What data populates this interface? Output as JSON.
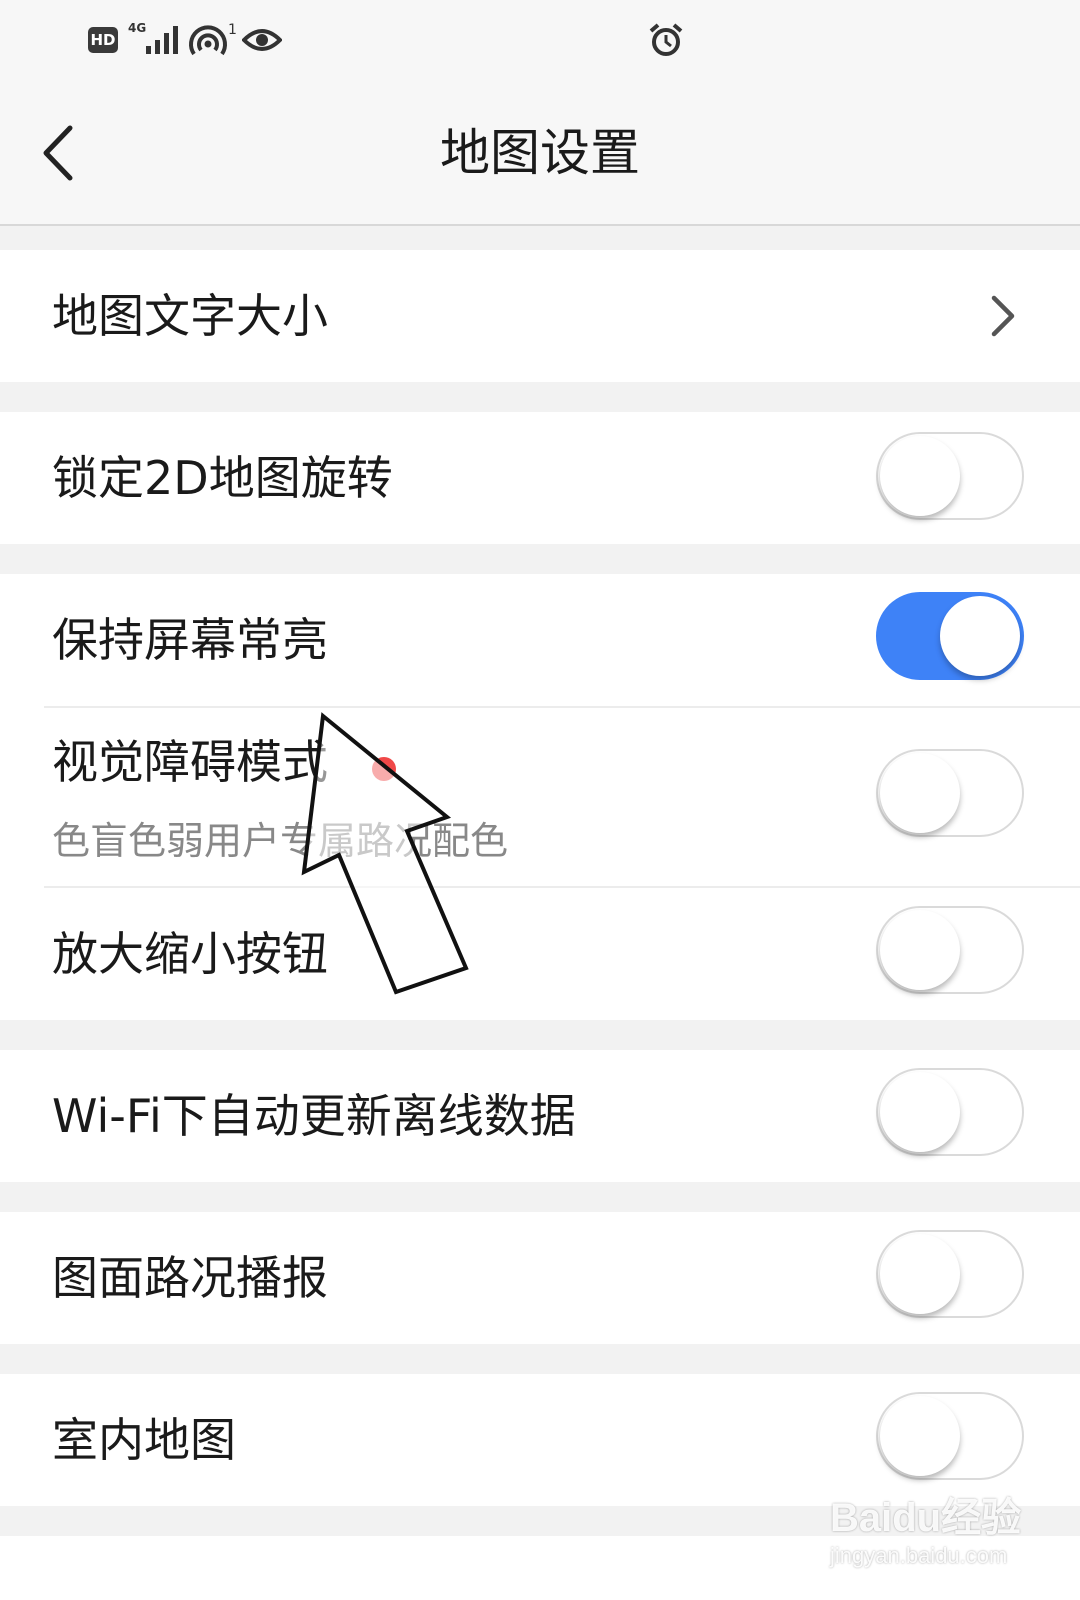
{
  "status_bar": {
    "hd_badge": "HD",
    "network_type": "4G",
    "hotspot_count": "1",
    "icons": [
      "hd-icon",
      "signal-icon",
      "hotspot-icon",
      "eye-icon",
      "alarm-icon"
    ]
  },
  "header": {
    "title": "地图设置",
    "back_icon": "chevron-left-icon"
  },
  "settings": {
    "map_text_size": {
      "label": "地图文字大小"
    },
    "lock_2d_rotation": {
      "label": "锁定2D地图旋转",
      "enabled": false
    },
    "keep_screen_on": {
      "label": "保持屏幕常亮",
      "enabled": true
    },
    "visual_impairment_mode": {
      "label": "视觉障碍模式",
      "subtitle": "色盲色弱用户专属路况配色",
      "enabled": false,
      "has_new_dot": true
    },
    "zoom_buttons": {
      "label": "放大缩小按钮",
      "enabled": false
    },
    "wifi_offline_update": {
      "label": "Wi-Fi下自动更新离线数据",
      "enabled": false
    },
    "traffic_broadcast": {
      "label": "图面路况播报",
      "enabled": false
    },
    "indoor_map": {
      "label": "室内地图",
      "enabled": false
    }
  },
  "colors": {
    "toggle_on": "#3e82f7",
    "new_dot": "#f04848",
    "background": "#f2f2f2"
  },
  "watermark": {
    "logo": "Baidu经验",
    "url": "jingyan.baidu.com"
  }
}
